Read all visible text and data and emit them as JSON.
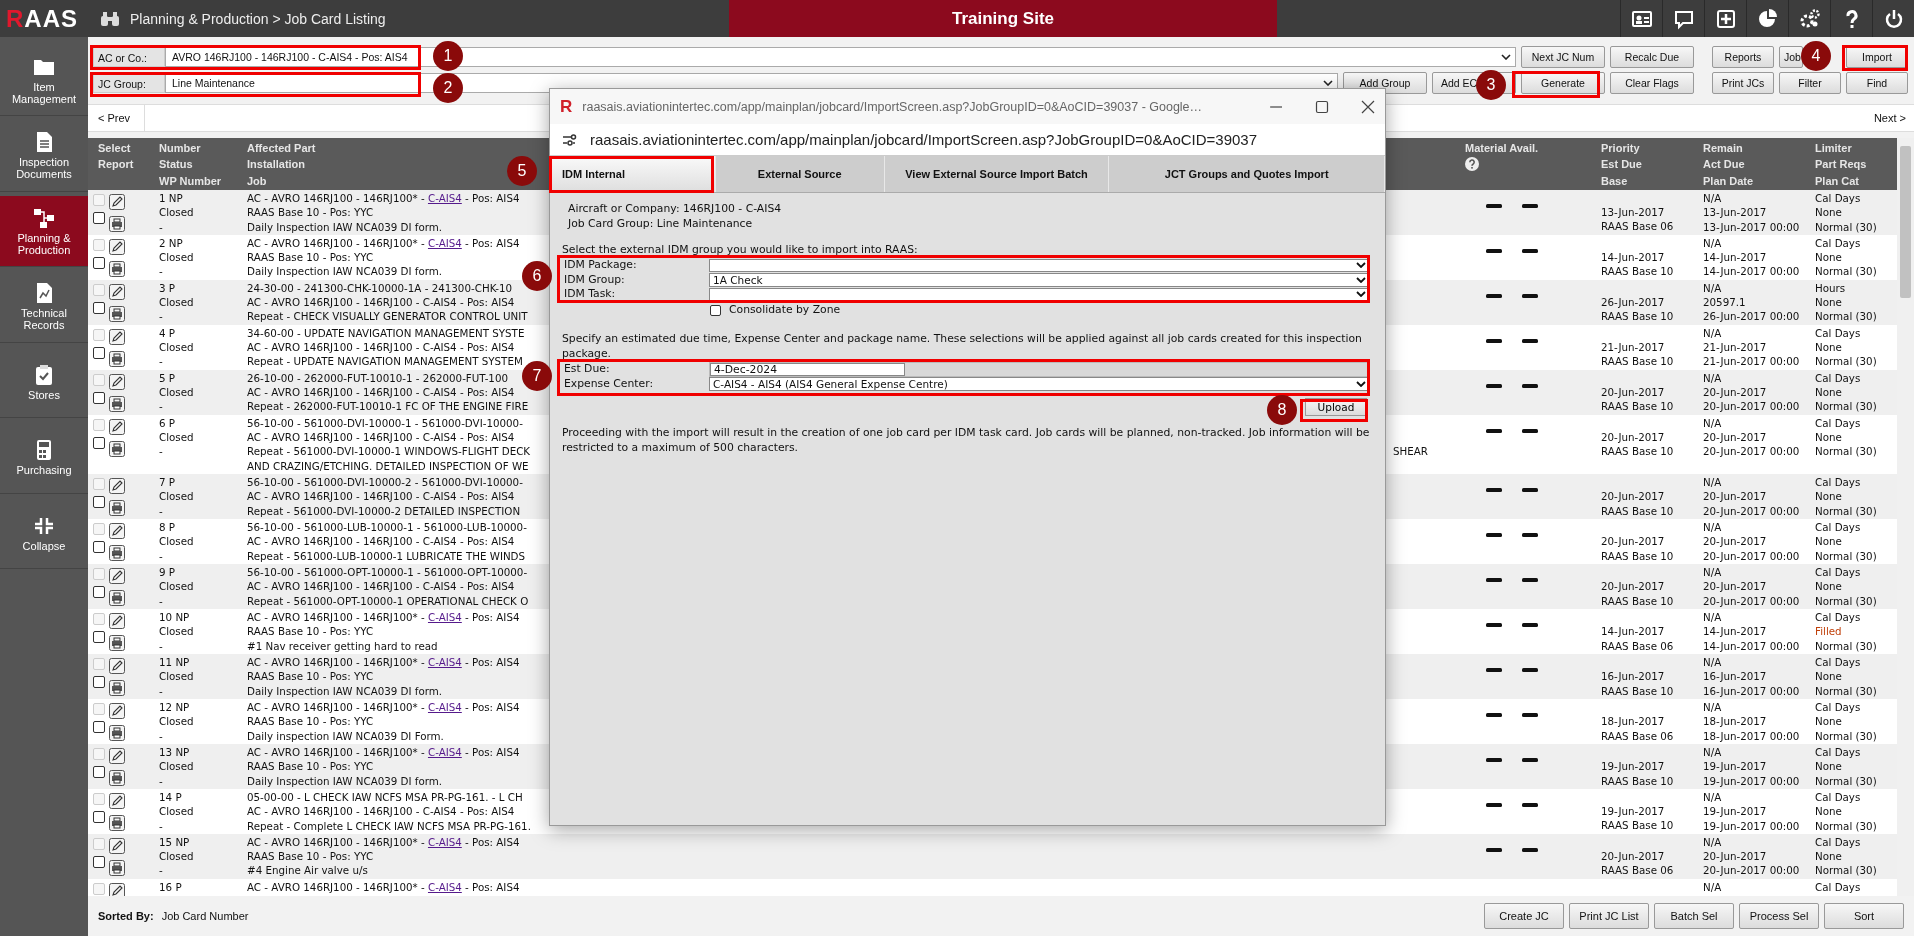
{
  "topbar": {
    "logo": "RAAS",
    "breadcrumb": "Planning & Production > Job Card Listing",
    "banner": "Training Site"
  },
  "sidebar": [
    {
      "label": "Item Management",
      "selected": false
    },
    {
      "label": "Inspection Documents",
      "selected": false
    },
    {
      "label": "Planning & Production",
      "selected": true
    },
    {
      "label": "Technical Records",
      "selected": false
    },
    {
      "label": "Stores",
      "selected": false
    },
    {
      "label": "Purchasing",
      "selected": false
    },
    {
      "label": "Collapse",
      "selected": false
    }
  ],
  "filters": [
    {
      "label": "AC or Co.:",
      "value": "AVRO 146RJ100 - 146RJ100 - C-AIS4 - Pos: AIS4"
    },
    {
      "label": "JC Group:",
      "value": "Line Maintenance"
    }
  ],
  "row1_buttons": [
    "Next JC Num",
    "Recalc Due"
  ],
  "row1_right_buttons": [
    "Reports",
    "Job",
    "Import"
  ],
  "row2_buttons": [
    "Add Group",
    "Add EC",
    "Generate",
    "Clear Flags"
  ],
  "row2_right_buttons": [
    "Print JCs",
    "Filter",
    "Find"
  ],
  "pager": {
    "prev": "< Prev",
    "next": "Next >"
  },
  "table": {
    "columns": [
      [
        "Select",
        "Report"
      ],
      [
        "Number",
        "Status",
        "WP Number"
      ],
      [
        "Affected Part",
        "Installation",
        "Job"
      ],
      [
        "Material Avail."
      ],
      [
        "Priority",
        "Est Due",
        "Base"
      ],
      [
        "Remain",
        "Act Due",
        "Plan Date"
      ],
      [
        "Limiter",
        "Part Reqs",
        "Plan Cat"
      ]
    ],
    "rows": [
      {
        "kind": "full",
        "select_disabled": true,
        "select_checked": false,
        "report_checked": false,
        "number": "1 NP",
        "status": "Closed",
        "wp": "-",
        "job": [
          {
            "text": "AC - AVRO 146RJ100 - 146RJ100* - ",
            "link": "C-AIS4",
            "after": " - Pos: AIS4"
          },
          {
            "text": "RAAS Base 10 - Pos: YYC"
          },
          {
            "text": "Daily Inspection IAW NCA039 DI form."
          }
        ],
        "est_due": "13-Jun-2017",
        "base": "RAAS Base 06",
        "remain": "N/A",
        "act_due": "13-Jun-2017",
        "plan_date": "13-Jun-2017 00:00",
        "limiter": "Cal Days",
        "part_reqs": "None",
        "part_reqs_flagged": false,
        "plan_cat": "Normal (30)"
      },
      {
        "kind": "full",
        "select_disabled": true,
        "select_checked": false,
        "report_checked": false,
        "number": "2 NP",
        "status": "Closed",
        "wp": "-",
        "job": [
          {
            "text": "AC - AVRO 146RJ100 - 146RJ100* - ",
            "link": "C-AIS4",
            "after": " - Pos: AIS4"
          },
          {
            "text": "RAAS Base 10 - Pos: YYC"
          },
          {
            "text": "Daily Inspection IAW NCA039 DI form."
          }
        ],
        "est_due": "14-Jun-2017",
        "base": "RAAS Base 10",
        "remain": "N/A",
        "act_due": "14-Jun-2017",
        "plan_date": "14-Jun-2017 00:00",
        "limiter": "Cal Days",
        "part_reqs": "None",
        "part_reqs_flagged": false,
        "plan_cat": "Normal (30)"
      },
      {
        "kind": "full",
        "select_disabled": true,
        "select_checked": false,
        "report_checked": false,
        "number": "3 P",
        "status": "Closed",
        "wp": "-",
        "job": [
          {
            "text": "24-30-00 - 241300-CHK-10000-1A - 241300-CHK-10"
          },
          {
            "text": "AC - AVRO 146RJ100 - 146RJ100 - C-AIS4 - Pos: AIS4"
          },
          {
            "text": "Repeat - CHECK VISUALLY GENERATOR CONTROL UNIT"
          }
        ],
        "est_due": "26-Jun-2017",
        "base": "RAAS Base 10",
        "remain": "N/A",
        "act_due": "20597.1",
        "plan_date": "26-Jun-2017 00:00",
        "limiter": "Hours",
        "part_reqs": "None",
        "part_reqs_flagged": false,
        "plan_cat": "Normal (30)"
      },
      {
        "kind": "full",
        "select_disabled": true,
        "select_checked": false,
        "report_checked": false,
        "number": "4 P",
        "status": "Closed",
        "wp": "-",
        "job": [
          {
            "text": "34-60-00 - UPDATE NAVIGATION MANAGEMENT SYSTE"
          },
          {
            "text": "AC - AVRO 146RJ100 - 146RJ100 - C-AIS4 - Pos: AIS4"
          },
          {
            "text": "Repeat - UPDATE NAVIGATION MANAGEMENT SYSTEM"
          }
        ],
        "est_due": "21-Jun-2017",
        "base": "RAAS Base 10",
        "remain": "N/A",
        "act_due": "21-Jun-2017",
        "plan_date": "21-Jun-2017 00:00",
        "limiter": "Cal Days",
        "part_reqs": "None",
        "part_reqs_flagged": false,
        "plan_cat": "Normal (30)"
      },
      {
        "kind": "full",
        "select_disabled": true,
        "select_checked": false,
        "report_checked": false,
        "number": "5 P",
        "status": "Closed",
        "wp": "-",
        "job": [
          {
            "text": "26-10-00 - 262000-FUT-10010-1 - 262000-FUT-100"
          },
          {
            "text": "AC - AVRO 146RJ100 - 146RJ100 - C-AIS4 - Pos: AIS4"
          },
          {
            "text": "Repeat - 262000-FUT-10010-1 FC OF THE ENGINE FIRE"
          }
        ],
        "est_due": "20-Jun-2017",
        "base": "RAAS Base 10",
        "remain": "N/A",
        "act_due": "20-Jun-2017",
        "plan_date": "20-Jun-2017 00:00",
        "limiter": "Cal Days",
        "part_reqs": "None",
        "part_reqs_flagged": false,
        "plan_cat": "Normal (30)"
      },
      {
        "kind": "full",
        "select_disabled": true,
        "select_checked": false,
        "report_checked": false,
        "number": "6 P",
        "status": "Closed",
        "wp": "-",
        "job": [
          {
            "text": "56-10-00 - 561000-DVI-10000-1 - 561000-DVI-10000-"
          },
          {
            "text": "AC - AVRO 146RJ100 - 146RJ100 - C-AIS4 - Pos: AIS4"
          },
          {
            "text": "Repeat - 561000-DVI-10000-1 WINDOWS-FLIGHT DECK",
            "tail": "SHEAR"
          },
          {
            "text": "AND CRAZING/ETCHING. DETAILED INSPECTION OF WE"
          }
        ],
        "est_due": "20-Jun-2017",
        "base": "RAAS Base 10",
        "remain": "N/A",
        "act_due": "20-Jun-2017",
        "plan_date": "20-Jun-2017 00:00",
        "limiter": "Cal Days",
        "part_reqs": "None",
        "part_reqs_flagged": false,
        "plan_cat": "Normal (30)"
      },
      {
        "kind": "full",
        "select_disabled": true,
        "select_checked": false,
        "report_checked": false,
        "number": "7 P",
        "status": "Closed",
        "wp": "-",
        "job": [
          {
            "text": "56-10-00 - 561000-DVI-10000-2 - 561000-DVI-10000-"
          },
          {
            "text": "AC - AVRO 146RJ100 - 146RJ100 - C-AIS4 - Pos: AIS4"
          },
          {
            "text": "Repeat - 561000-DVI-10000-2 DETAILED INSPECTION"
          }
        ],
        "est_due": "20-Jun-2017",
        "base": "RAAS Base 10",
        "remain": "N/A",
        "act_due": "20-Jun-2017",
        "plan_date": "20-Jun-2017 00:00",
        "limiter": "Cal Days",
        "part_reqs": "None",
        "part_reqs_flagged": false,
        "plan_cat": "Normal (30)"
      },
      {
        "kind": "full",
        "select_disabled": true,
        "select_checked": false,
        "report_checked": false,
        "number": "8 P",
        "status": "Closed",
        "wp": "-",
        "job": [
          {
            "text": "56-10-00 - 561000-LUB-10000-1 - 561000-LUB-10000-"
          },
          {
            "text": "AC - AVRO 146RJ100 - 146RJ100 - C-AIS4 - Pos: AIS4"
          },
          {
            "text": "Repeat - 561000-LUB-10000-1 LUBRICATE THE WINDS"
          }
        ],
        "est_due": "20-Jun-2017",
        "base": "RAAS Base 10",
        "remain": "N/A",
        "act_due": "20-Jun-2017",
        "plan_date": "20-Jun-2017 00:00",
        "limiter": "Cal Days",
        "part_reqs": "None",
        "part_reqs_flagged": false,
        "plan_cat": "Normal (30)"
      },
      {
        "kind": "full",
        "select_disabled": true,
        "select_checked": false,
        "report_checked": false,
        "number": "9 P",
        "status": "Closed",
        "wp": "-",
        "job": [
          {
            "text": "56-10-00 - 561000-OPT-10000-1 - 561000-OPT-10000-"
          },
          {
            "text": "AC - AVRO 146RJ100 - 146RJ100 - C-AIS4 - Pos: AIS4"
          },
          {
            "text": "Repeat - 561000-OPT-10000-1 OPERATIONAL CHECK O"
          }
        ],
        "est_due": "20-Jun-2017",
        "base": "RAAS Base 10",
        "remain": "N/A",
        "act_due": "20-Jun-2017",
        "plan_date": "20-Jun-2017 00:00",
        "limiter": "Cal Days",
        "part_reqs": "None",
        "part_reqs_flagged": false,
        "plan_cat": "Normal (30)"
      },
      {
        "kind": "full",
        "select_disabled": true,
        "select_checked": false,
        "report_checked": false,
        "number": "10 NP",
        "status": "Closed",
        "wp": "-",
        "job": [
          {
            "text": "AC - AVRO 146RJ100 - 146RJ100* - ",
            "link": "C-AIS4",
            "after": " - Pos: AIS4"
          },
          {
            "text": "RAAS Base 10 - Pos: YYC"
          },
          {
            "text": "#1 Nav receiver getting hard to read"
          }
        ],
        "est_due": "14-Jun-2017",
        "base": "RAAS Base 06",
        "remain": "N/A",
        "act_due": "14-Jun-2017",
        "plan_date": "14-Jun-2017 00:00",
        "limiter": "Cal Days",
        "part_reqs": "Filled",
        "part_reqs_flagged": true,
        "plan_cat": "Normal (30)"
      },
      {
        "kind": "full",
        "select_disabled": true,
        "select_checked": false,
        "report_checked": false,
        "number": "11 NP",
        "status": "Closed",
        "wp": "-",
        "job": [
          {
            "text": "AC - AVRO 146RJ100 - 146RJ100* - ",
            "link": "C-AIS4",
            "after": " - Pos: AIS4"
          },
          {
            "text": "RAAS Base 10 - Pos: YYC"
          },
          {
            "text": "Daily Inspection IAW NCA039 DI form."
          }
        ],
        "est_due": "16-Jun-2017",
        "base": "RAAS Base 10",
        "remain": "N/A",
        "act_due": "16-Jun-2017",
        "plan_date": "16-Jun-2017 00:00",
        "limiter": "Cal Days",
        "part_reqs": "None",
        "part_reqs_flagged": false,
        "plan_cat": "Normal (30)"
      },
      {
        "kind": "full",
        "select_disabled": true,
        "select_checked": false,
        "report_checked": false,
        "number": "12 NP",
        "status": "Closed",
        "wp": "-",
        "job": [
          {
            "text": "AC - AVRO 146RJ100 - 146RJ100* - ",
            "link": "C-AIS4",
            "after": " - Pos: AIS4"
          },
          {
            "text": "RAAS Base 10 - Pos: YYC"
          },
          {
            "text": "Daily inspection IAW NCA039 DI Form."
          }
        ],
        "est_due": "18-Jun-2017",
        "base": "RAAS Base 06",
        "remain": "N/A",
        "act_due": "18-Jun-2017",
        "plan_date": "18-Jun-2017 00:00",
        "limiter": "Cal Days",
        "part_reqs": "None",
        "part_reqs_flagged": false,
        "plan_cat": "Normal (30)"
      },
      {
        "kind": "full",
        "select_disabled": true,
        "select_checked": false,
        "report_checked": false,
        "number": "13 NP",
        "status": "Closed",
        "wp": "-",
        "job": [
          {
            "text": "AC - AVRO 146RJ100 - 146RJ100* - ",
            "link": "C-AIS4",
            "after": " - Pos: AIS4"
          },
          {
            "text": "RAAS Base 10 - Pos: YYC"
          },
          {
            "text": "Daily Inspection IAW NCA039 DI form."
          }
        ],
        "est_due": "19-Jun-2017",
        "base": "RAAS Base 10",
        "remain": "N/A",
        "act_due": "19-Jun-2017",
        "plan_date": "19-Jun-2017 00:00",
        "limiter": "Cal Days",
        "part_reqs": "None",
        "part_reqs_flagged": false,
        "plan_cat": "Normal (30)"
      },
      {
        "kind": "full",
        "select_disabled": true,
        "select_checked": false,
        "report_checked": false,
        "number": "14 P",
        "status": "Closed",
        "wp": "-",
        "job": [
          {
            "text": "05-00-00 - L CHECK IAW NCFS MSA PR-PG-161. - L CH"
          },
          {
            "text": "AC - AVRO 146RJ100 - 146RJ100 - C-AIS4 - Pos: AIS4"
          },
          {
            "text": "Repeat - Complete L CHECK IAW NCFS MSA PR-PG-161."
          }
        ],
        "est_due": "19-Jun-2017",
        "base": "RAAS Base 10",
        "remain": "N/A",
        "act_due": "19-Jun-2017",
        "plan_date": "19-Jun-2017 00:00",
        "limiter": "Cal Days",
        "part_reqs": "None",
        "part_reqs_flagged": false,
        "plan_cat": "Normal (30)"
      },
      {
        "kind": "full",
        "select_disabled": true,
        "select_checked": false,
        "report_checked": false,
        "number": "15 NP",
        "status": "Closed",
        "wp": "-",
        "job": [
          {
            "text": "AC - AVRO 146RJ100 - 146RJ100* - ",
            "link": "C-AIS4",
            "after": " - Pos: AIS4"
          },
          {
            "text": "RAAS Base 10 - Pos: YYC"
          },
          {
            "text": "#4 Engine Air valve u/s"
          }
        ],
        "est_due": "20-Jun-2017",
        "base": "RAAS Base 06",
        "remain": "N/A",
        "act_due": "20-Jun-2017",
        "plan_date": "20-Jun-2017 00:00",
        "limiter": "Cal Days",
        "part_reqs": "None",
        "part_reqs_flagged": false,
        "plan_cat": "Normal (30)"
      },
      {
        "kind": "partial",
        "select_disabled": true,
        "select_checked": false,
        "number": "16 P",
        "job": [
          {
            "text": "AC - AVRO 146RJ100 - 146RJ100* - ",
            "link": "C-AIS4",
            "after": " - Pos: AIS4"
          }
        ],
        "remain": "N/A",
        "limiter": "Cal Days"
      }
    ]
  },
  "footer": {
    "sorted_by_label": "Sorted By:",
    "sorted_by": "Job Card Number",
    "buttons": [
      "Create JC",
      "Print JC List",
      "Batch Sel",
      "Process Sel",
      "Sort"
    ]
  },
  "popup": {
    "logo": "R",
    "title": "raasais.aviationintertec.com/app/mainplan/jobcard/ImportScreen.asp?JobGroupID=0&AoCID=39037 - Google…",
    "url": "raasais.aviationintertec.com/app/mainplan/jobcard/ImportScreen.asp?JobGroupID=0&AoCID=39037",
    "tabs": [
      {
        "label": "IDM Internal",
        "selected": true
      },
      {
        "label": "External Source",
        "selected": false
      },
      {
        "label": "View External Source Import Batch",
        "selected": false
      },
      {
        "label": "JCT Groups and Quotes Import",
        "selected": false
      }
    ],
    "info": [
      "Aircraft or Company: 146RJ100 - C-AIS4",
      "Job Card Group: Line Maintenance"
    ],
    "prompt": "Select the external IDM group you would like to import into RAAS:",
    "idm_fields": [
      {
        "label": "IDM Package:"
      },
      {
        "label": "IDM Group:",
        "value": "1A Check"
      },
      {
        "label": "IDM Task:"
      }
    ],
    "consolidate": {
      "label": "Consolidate by Zone",
      "checked": false
    },
    "specify": "Specify an estimated due time, Expense Center and package name. These selections will be applied against all job cards created for this inspection package.",
    "est_due": {
      "label": "Est Due:",
      "value": "4-Dec-2024"
    },
    "expense_center": {
      "label": "Expense Center:",
      "value": "C-AIS4 - AIS4 (AIS4 General Expense Centre)"
    },
    "upload": "Upload",
    "note": "Proceeding with the import will result in the creation of one job card per IDM task card. Job cards will be planned, non-tracked. Job information will be restricted to a maximum of 500 characters."
  },
  "annotations": [
    "1",
    "2",
    "3",
    "4",
    "5",
    "6",
    "7",
    "8"
  ]
}
